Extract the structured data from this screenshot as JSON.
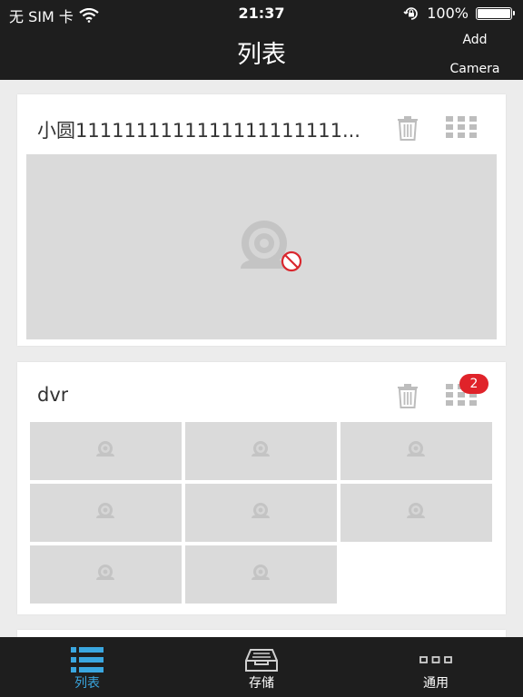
{
  "status_bar": {
    "carrier": "无 SIM 卡",
    "time": "21:37",
    "battery_percent": "100%",
    "battery_level": 1.0
  },
  "nav": {
    "title": "列表",
    "add_camera_line1": "Add",
    "add_camera_line2": "Camera"
  },
  "cards": [
    {
      "title": "小圆1111111111111111111111...",
      "channels": 1
    },
    {
      "title": "dvr",
      "badge": "2",
      "channels": 8
    }
  ],
  "tabs": [
    {
      "label": "列表",
      "icon": "list-icon",
      "active": true
    },
    {
      "label": "存储",
      "icon": "storage-icon",
      "active": false
    },
    {
      "label": "通用",
      "icon": "more-icon",
      "active": false
    }
  ],
  "colors": {
    "bar_bg": "#1e1e1e",
    "accent": "#3aa7e0",
    "badge": "#e0232a",
    "preview_bg": "#dadada",
    "icon_gray": "#bdbdbd"
  }
}
